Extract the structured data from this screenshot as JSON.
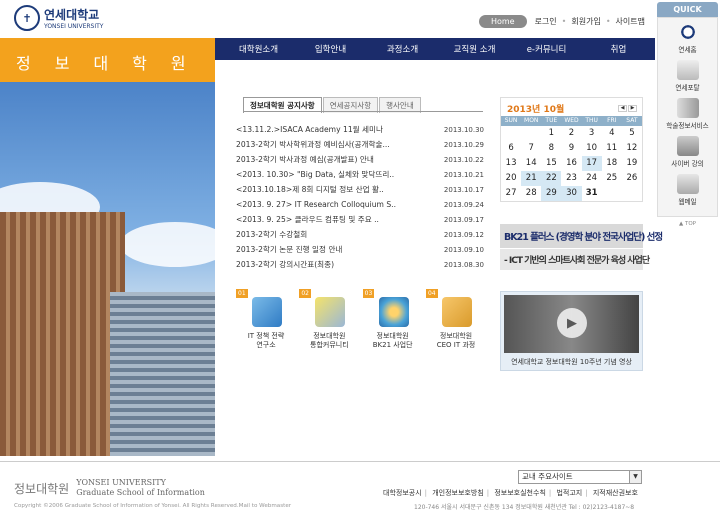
{
  "header": {
    "logo_kr": "연세대학교",
    "logo_en": "YONSEI UNIVERSITY",
    "home_label": "Home",
    "links": [
      "로그인",
      "회원가입",
      "사이트맵"
    ]
  },
  "site_title": "정보대학원",
  "nav": [
    "대학원소개",
    "입학안내",
    "과정소개",
    "교직원 소개",
    "e-커뮤니티",
    "취업"
  ],
  "tabs": [
    "정보대학원 공지사항",
    "연세공지사항",
    "행사안내"
  ],
  "news": [
    {
      "title": "<13.11.2.>ISACA Academy 11월 세미나",
      "date": "2013.10.30"
    },
    {
      "title": "2013-2학기 박사학위과정 예비심사(공개학술...",
      "date": "2013.10.29"
    },
    {
      "title": "2013-2학기 박사과정 예심(공개발표) 안내",
      "date": "2013.10.22"
    },
    {
      "title": "<2013. 10.30> \"Big Data, 실체와 맞닥뜨리..",
      "date": "2013.10.21"
    },
    {
      "title": "<2013.10.18>제 8회 디지털 정보 산업 활..",
      "date": "2013.10.17"
    },
    {
      "title": "<2013. 9. 27> IT Research Colloquium S..",
      "date": "2013.09.24"
    },
    {
      "title": "<2013. 9. 25> 클라우드 컴퓨팅 및 주요 ..",
      "date": "2013.09.17"
    },
    {
      "title": "2013-2학기 수강철회",
      "date": "2013.09.12"
    },
    {
      "title": "2013-2학기 논문 진행 일정 안내",
      "date": "2013.09.10"
    },
    {
      "title": "2013-2학기 강의시간표(최종)",
      "date": "2013.08.30"
    }
  ],
  "calendar": {
    "title": "2013년 10월",
    "days": [
      "SUN",
      "MON",
      "TUE",
      "WED",
      "THU",
      "FRI",
      "SAT"
    ],
    "weeks": [
      [
        "",
        "",
        "1",
        "2",
        "3",
        "4",
        "5"
      ],
      [
        "6",
        "7",
        "8",
        "9",
        "10",
        "11",
        "12"
      ],
      [
        "13",
        "14",
        "15",
        "16",
        "17",
        "18",
        "19"
      ],
      [
        "20",
        "21",
        "22",
        "23",
        "24",
        "25",
        "26"
      ],
      [
        "27",
        "28",
        "29",
        "30",
        "31",
        "",
        ""
      ]
    ]
  },
  "bk21": {
    "line1": "BK21 플러스 (경영학 분야 전국사업단) 선정",
    "line2": "- ICT 기반의 스마트사회 전문가 육성 사업단"
  },
  "video_caption": "연세대학교 정보대학원 10주년 기념 영상",
  "quick_links": [
    {
      "num": "01",
      "label1": "IT 정책 전략",
      "label2": "연구소"
    },
    {
      "num": "02",
      "label1": "정보대학원",
      "label2": "통합커뮤니티"
    },
    {
      "num": "03",
      "label1": "정보대학원",
      "label2": "BK21 사업단"
    },
    {
      "num": "04",
      "label1": "정보대학원",
      "label2": "CEO IT 과정"
    }
  ],
  "quick_panel": {
    "title": "QUICK",
    "items": [
      "연세홈",
      "연세포탈",
      "학술정보서비스",
      "사이버 강의",
      "웹메일"
    ],
    "top_label": "TOP"
  },
  "footer": {
    "logo_kr": "정보대학원",
    "logo_en1": "YONSEI UNIVERSITY",
    "logo_en2": "Graduate School of Information",
    "copyright": "Copyright ©2006 Graduate School of Information of Yonsei. All Rights Reserved.Mail to Webmaster",
    "select_label": "교내 주요사이트",
    "links": [
      "대학정보공시",
      "개인정보보호방침",
      "정보보호실천수칙",
      "법적고지",
      "지적재산권보호"
    ],
    "address": "120-746 서울시 서대문구 신촌동 134 정보대학원 새천년관  Tel : 02)2123-4187~8"
  }
}
